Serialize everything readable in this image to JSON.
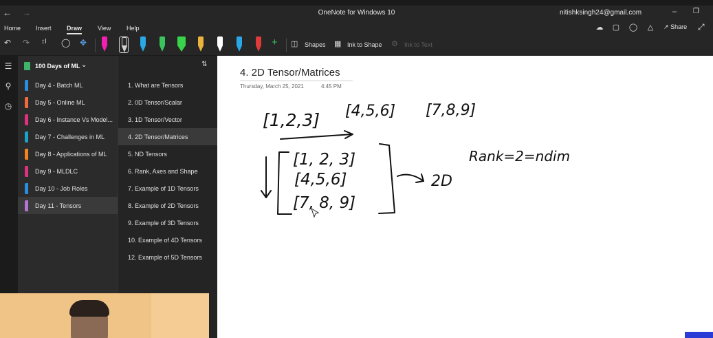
{
  "titlebar": {
    "app_title": "OneNote for Windows 10",
    "account_email": "nitishksingh24@gmail.com"
  },
  "ribbon": {
    "tabs": [
      "Home",
      "Insert",
      "Draw",
      "View",
      "Help"
    ],
    "active_tab": "Draw",
    "share_label": "Share"
  },
  "toolbar": {
    "shapes_label": "Shapes",
    "ink_to_shape_label": "Ink to Shape",
    "ink_to_text_label": "Ink to Text",
    "pen_colors": [
      "#f21fb0",
      "#2b2b2b",
      "#2aa7e5",
      "#39c45c",
      "#3ad24a",
      "#e9b33d",
      "#ffffff",
      "#2aa7e5",
      "#e03a3a"
    ]
  },
  "notebook": {
    "name": "100 Days of ML",
    "color": "#3fb56a"
  },
  "sections": [
    {
      "label": "Day 4 - Batch ML",
      "color": "#2a8de0"
    },
    {
      "label": "Day 5 - Online ML",
      "color": "#f06a3c"
    },
    {
      "label": "Day 6 - Instance Vs Model...",
      "color": "#e0307f"
    },
    {
      "label": "Day 7 - Challenges in ML",
      "color": "#1aa3c9"
    },
    {
      "label": "Day 8 - Applications of ML",
      "color": "#f58220"
    },
    {
      "label": "Day 9 - MLDLC",
      "color": "#e0307f"
    },
    {
      "label": "Day 10 - Job Roles",
      "color": "#2a8de0"
    },
    {
      "label": "Day 11 - Tensors",
      "color": "#b673d6"
    }
  ],
  "selected_section": "Day 11 - Tensors",
  "pages": [
    {
      "label": "1. What are Tensors"
    },
    {
      "label": "2. 0D Tensor/Scalar"
    },
    {
      "label": "3. 1D Tensor/Vector"
    },
    {
      "label": "4. 2D Tensor/Matrices"
    },
    {
      "label": "5. ND Tensors"
    },
    {
      "label": "6. Rank, Axes and Shape"
    },
    {
      "label": "7. Example of 1D Tensors"
    },
    {
      "label": "8. Example of 2D Tensors"
    },
    {
      "label": "9. Example of 3D Tensors"
    },
    {
      "label": "10. Example of 4D Tensors"
    },
    {
      "label": "12. Example of 5D Tensors"
    }
  ],
  "selected_page": "4. 2D Tensor/Matrices",
  "page": {
    "title": "4. 2D Tensor/Matrices",
    "date": "Thursday, March 25, 2021",
    "time": "4:45 PM"
  },
  "ink_notes": {
    "row_vectors": [
      "[1,2,3]",
      "[4,5,6]",
      "[7,8,9]"
    ],
    "matrix_rows": [
      "[1, 2, 3]",
      "[4,5,6]",
      "[7, 8, 9]"
    ],
    "dim_label": "2D",
    "rank_note": "Rank=2=ndim"
  }
}
